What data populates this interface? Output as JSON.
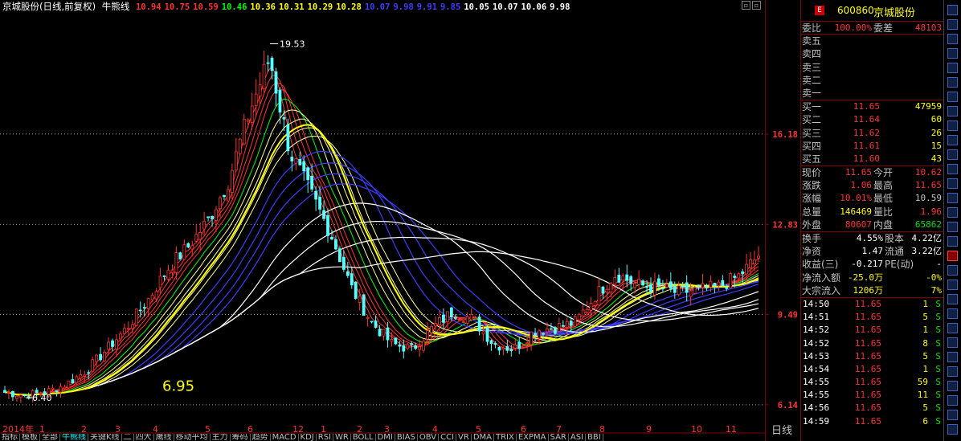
{
  "header": {
    "title": "京城股份(日线,前复权)",
    "indicator": "牛熊线",
    "values": [
      {
        "v": "10.94",
        "color": "#ff3232"
      },
      {
        "v": "10.75",
        "color": "#ff3232"
      },
      {
        "v": "10.59",
        "color": "#ff3232"
      },
      {
        "v": "10.46",
        "color": "#00ff00"
      },
      {
        "v": "10.36",
        "color": "#ffff00"
      },
      {
        "v": "10.31",
        "color": "#ffff00"
      },
      {
        "v": "10.29",
        "color": "#ffff00"
      },
      {
        "v": "10.28",
        "color": "#ffff00"
      },
      {
        "v": "10.07",
        "color": "#3c3cff"
      },
      {
        "v": "9.98",
        "color": "#3c3cff"
      },
      {
        "v": "9.91",
        "color": "#3c3cff"
      },
      {
        "v": "9.85",
        "color": "#3c3cff"
      },
      {
        "v": "10.05",
        "color": "#ffffff"
      },
      {
        "v": "10.07",
        "color": "#ffffff"
      },
      {
        "v": "10.06",
        "color": "#ffffff"
      },
      {
        "v": "9.98",
        "color": "#ffffff"
      }
    ],
    "btn_restore": "▫",
    "btn_close": "▫"
  },
  "chart_data": {
    "type": "candlestick",
    "y_ticks": [
      16.18,
      12.83,
      9.49,
      6.14
    ],
    "high_label": "19.53",
    "low_label": "6.40",
    "annotation": "6.95",
    "x_labels": [
      "2014年",
      "1",
      "2",
      "3",
      "4",
      "5",
      "6",
      "12",
      "1",
      "2",
      "3",
      "4",
      "5",
      "6",
      "7",
      "8",
      "9",
      "10",
      "11"
    ],
    "approx_close_path": [
      6.6,
      6.5,
      6.6,
      6.9,
      7.4,
      8.2,
      9.0,
      10.0,
      11.2,
      12.0,
      13.0,
      14.5,
      17.0,
      19.0,
      15.5,
      14.0,
      12.5,
      10.5,
      9.2,
      8.4,
      8.2,
      9.0,
      9.6,
      9.3,
      8.4,
      8.2,
      8.9,
      9.0,
      9.2,
      10.2,
      11.0,
      10.6,
      10.5,
      10.3,
      10.4,
      10.5,
      10.9,
      11.65
    ]
  },
  "tabs": [
    "指标",
    "模板",
    "全部",
    "牛熊线",
    "关键K线",
    "二",
    "四大",
    "鹰线",
    "移动平均",
    "主力",
    "筹码",
    "趋势",
    "MACD",
    "KDJ",
    "RSI",
    "WR",
    "BOLL",
    "DMI",
    "BIAS",
    "OBV",
    "CCI",
    "VR",
    "DMA",
    "TRIX",
    "EXPMA",
    "SAR",
    "ASI",
    "BBI"
  ],
  "active_tab": "牛熊线",
  "right": {
    "code": "600860",
    "name": "京城股份",
    "logo": "E",
    "weibi": {
      "label": "委比",
      "pct": "100.00%",
      "label2": "委差",
      "val": "48103"
    },
    "sell": [
      {
        "label": "卖五",
        "price": "",
        "vol": ""
      },
      {
        "label": "卖四",
        "price": "",
        "vol": ""
      },
      {
        "label": "卖三",
        "price": "",
        "vol": ""
      },
      {
        "label": "卖二",
        "price": "",
        "vol": ""
      },
      {
        "label": "卖一",
        "price": "",
        "vol": ""
      }
    ],
    "buy": [
      {
        "label": "买一",
        "price": "11.65",
        "vol": "47959"
      },
      {
        "label": "买二",
        "price": "11.64",
        "vol": "60"
      },
      {
        "label": "买三",
        "price": "11.62",
        "vol": "26"
      },
      {
        "label": "买四",
        "price": "11.61",
        "vol": "15"
      },
      {
        "label": "买五",
        "price": "11.60",
        "vol": "43"
      }
    ],
    "stats": [
      {
        "l1": "现价",
        "v1": "11.65",
        "c1": "red",
        "l2": "今开",
        "v2": "10.62",
        "c2": "red"
      },
      {
        "l1": "涨跌",
        "v1": "1.06",
        "c1": "red",
        "l2": "最高",
        "v2": "11.65",
        "c2": "red"
      },
      {
        "l1": "涨幅",
        "v1": "10.01%",
        "c1": "red",
        "l2": "最低",
        "v2": "10.59",
        "c2": "grey"
      },
      {
        "l1": "总量",
        "v1": "146469",
        "c1": "yellow",
        "l2": "量比",
        "v2": "1.96",
        "c2": "red"
      },
      {
        "l1": "外盘",
        "v1": "80607",
        "c1": "red",
        "l2": "内盘",
        "v2": "65862",
        "c2": "green"
      }
    ],
    "stats2": [
      {
        "l1": "换手",
        "v1": "4.55%",
        "c1": "white",
        "l2": "股本",
        "v2": "4.22亿",
        "c2": "white"
      },
      {
        "l1": "净资",
        "v1": "1.47",
        "c1": "white",
        "l2": "流通",
        "v2": "3.22亿",
        "c2": "white"
      },
      {
        "l1": "收益(三)",
        "v1": "-0.217",
        "c1": "white",
        "l2": "PE(动)",
        "v2": "-",
        "c2": "white"
      },
      {
        "l1": "净流入额",
        "v1": "-25.0万",
        "c1": "yellow",
        "l2": "",
        "v2": "-0%",
        "c2": "yellow"
      },
      {
        "l1": "大宗流入",
        "v1": "1206万",
        "c1": "yellow",
        "l2": "",
        "v2": "7%",
        "c2": "yellow"
      }
    ],
    "ticks": [
      {
        "t": "14:50",
        "p": "11.65",
        "v": "1",
        "s": "S"
      },
      {
        "t": "14:51",
        "p": "11.65",
        "v": "5",
        "s": "S"
      },
      {
        "t": "14:52",
        "p": "11.65",
        "v": "1",
        "s": "S"
      },
      {
        "t": "14:52",
        "p": "11.65",
        "v": "8",
        "s": "S"
      },
      {
        "t": "14:53",
        "p": "11.65",
        "v": "5",
        "s": "S"
      },
      {
        "t": "14:54",
        "p": "11.65",
        "v": "1",
        "s": "S"
      },
      {
        "t": "14:55",
        "p": "11.65",
        "v": "59",
        "s": "S"
      },
      {
        "t": "14:55",
        "p": "11.65",
        "v": "11",
        "s": "S"
      },
      {
        "t": "14:56",
        "p": "11.65",
        "v": "5",
        "s": "S"
      },
      {
        "t": "14:59",
        "p": "11.65",
        "v": "6",
        "s": "S"
      }
    ]
  },
  "day_label": "日线"
}
